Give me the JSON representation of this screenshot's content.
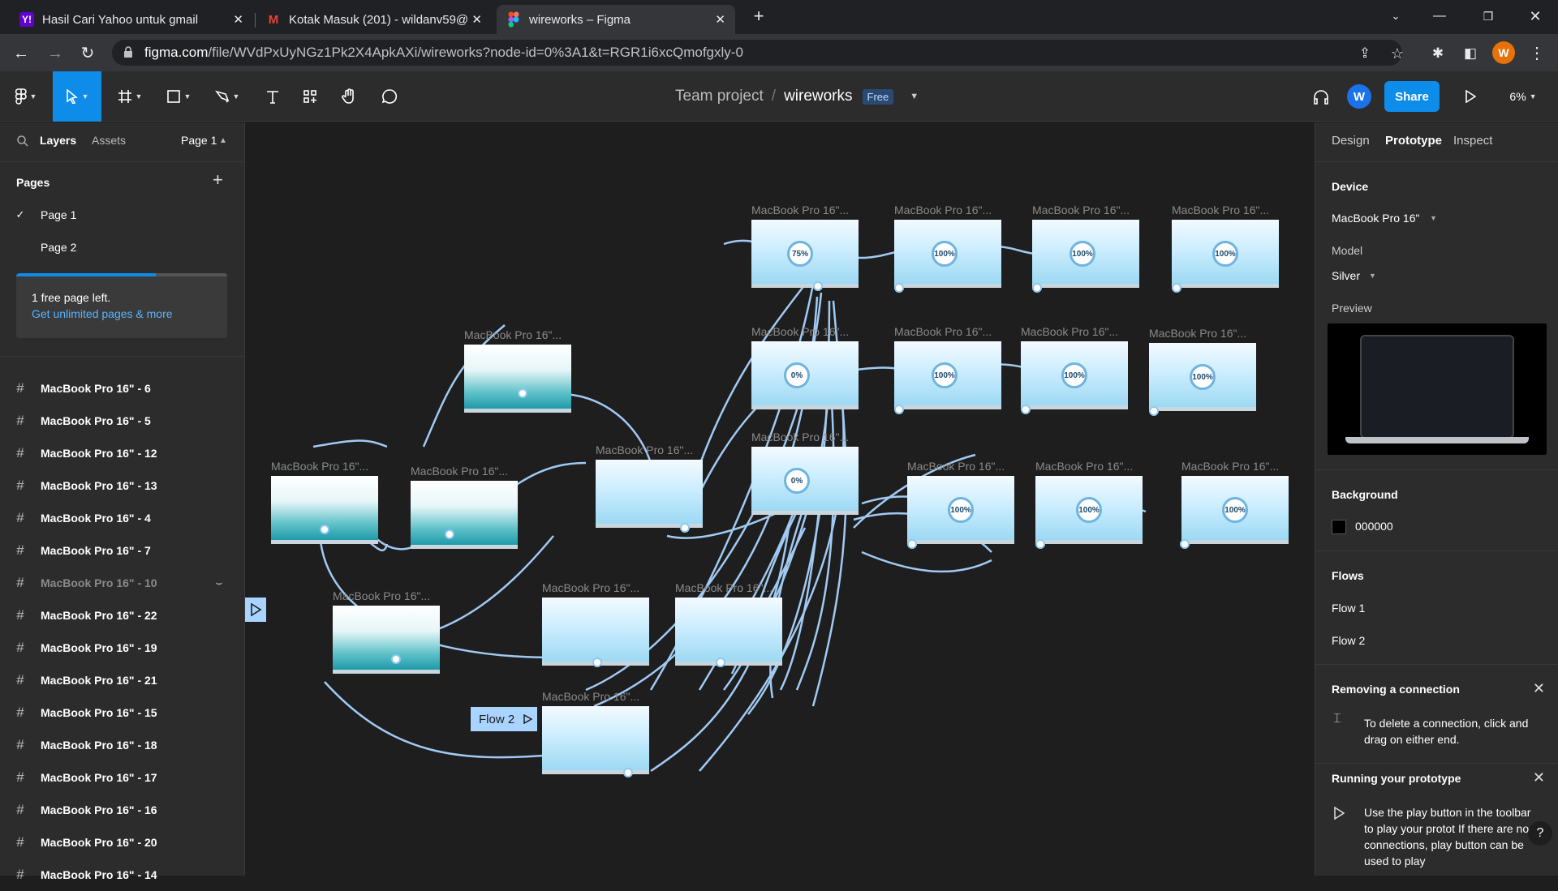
{
  "browser": {
    "tabs": [
      {
        "title": "Hasil Cari Yahoo untuk gmail",
        "icon": "yahoo-icon",
        "fav": "Y!"
      },
      {
        "title": "Kotak Masuk (201) - wildanv59@",
        "icon": "gmail-icon",
        "fav": "M"
      },
      {
        "title": "wireworks – Figma",
        "icon": "figma-icon",
        "fav": ""
      }
    ],
    "url_host": "figma.com",
    "url_path": "/file/WVdPxUyNGz1Pk2X4ApkAXi/wireworks?node-id=0%3A1&t=RGR1i6xcQmofgxly-0",
    "profile_initial": "W"
  },
  "toolbar": {
    "team": "Team project",
    "separator": "/",
    "file": "wireworks",
    "plan_badge": "Free",
    "avatar_initial": "W",
    "share_label": "Share",
    "zoom": "6%"
  },
  "left": {
    "tab_layers": "Layers",
    "tab_assets": "Assets",
    "page_selector": "Page 1",
    "pages_heading": "Pages",
    "pages": [
      "Page 1",
      "Page 2"
    ],
    "free_notice": "1 free page left.",
    "free_link": "Get unlimited pages & more",
    "layers": [
      "MacBook Pro 16\" - 6",
      "MacBook Pro 16\" - 5",
      "MacBook Pro 16\" - 12",
      "MacBook Pro 16\" - 13",
      "MacBook Pro 16\" - 4",
      "MacBook Pro 16\" - 7",
      "MacBook Pro 16\" - 10",
      "MacBook Pro 16\" - 22",
      "MacBook Pro 16\" - 19",
      "MacBook Pro 16\" - 21",
      "MacBook Pro 16\" - 15",
      "MacBook Pro 16\" - 18",
      "MacBook Pro 16\" - 17",
      "MacBook Pro 16\" - 16",
      "MacBook Pro 16\" - 20",
      "MacBook Pro 16\" - 14"
    ]
  },
  "right": {
    "tab_design": "Design",
    "tab_prototype": "Prototype",
    "tab_inspect": "Inspect",
    "device_heading": "Device",
    "device_value": "MacBook Pro 16\"",
    "model_label": "Model",
    "model_value": "Silver",
    "preview_label": "Preview",
    "background_heading": "Background",
    "background_hex": "000000",
    "flows_heading": "Flows",
    "flows": [
      "Flow 1",
      "Flow 2"
    ],
    "removing_heading": "Removing a connection",
    "removing_text": "To delete a connection, click and drag on either end.",
    "running_heading": "Running your prototype",
    "running_text": "Use the play button in the toolbar to play your protot If there are no connections, play button can be used to play",
    "help": "?"
  },
  "canvas": {
    "frame_label": "MacBook Pro 16\"...",
    "flow2_label": "Flow 2",
    "percents": [
      "75%",
      "100%",
      "100%",
      "100%",
      "0%",
      "100%",
      "100%",
      "100%",
      "0%",
      "100%",
      "100%",
      "100%"
    ]
  },
  "colors": {
    "accent": "#0d8ce9",
    "connector": "#a9d4ff",
    "canvas_bg": "#1e1e1e",
    "panel_bg": "#2c2c2c"
  }
}
